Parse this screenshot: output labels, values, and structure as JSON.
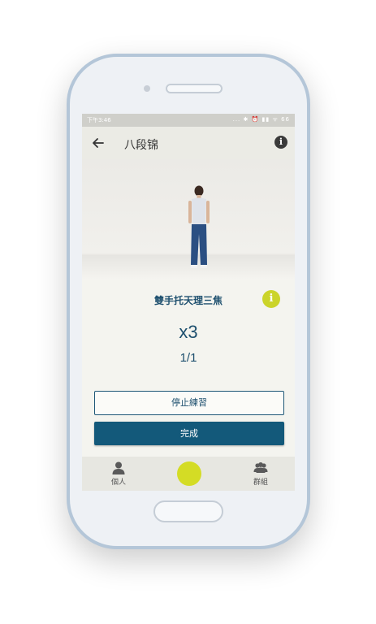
{
  "status_bar": {
    "time": "下午3:46",
    "icons": "... ✱ ⏰ ▮▮ ᯤ 66"
  },
  "app_bar": {
    "title": "八段锦"
  },
  "exercise": {
    "title": "雙手托天理三焦",
    "reps": "x3",
    "progress": "1/1"
  },
  "buttons": {
    "stop": "停止練習",
    "done": "完成"
  },
  "tabs": {
    "personal": "個人",
    "groups": "群組"
  },
  "colors": {
    "accent": "#13597a",
    "lime": "#cbd42a"
  },
  "icons": [
    "back-arrow-icon",
    "info-icon",
    "person-icon",
    "group-icon"
  ]
}
